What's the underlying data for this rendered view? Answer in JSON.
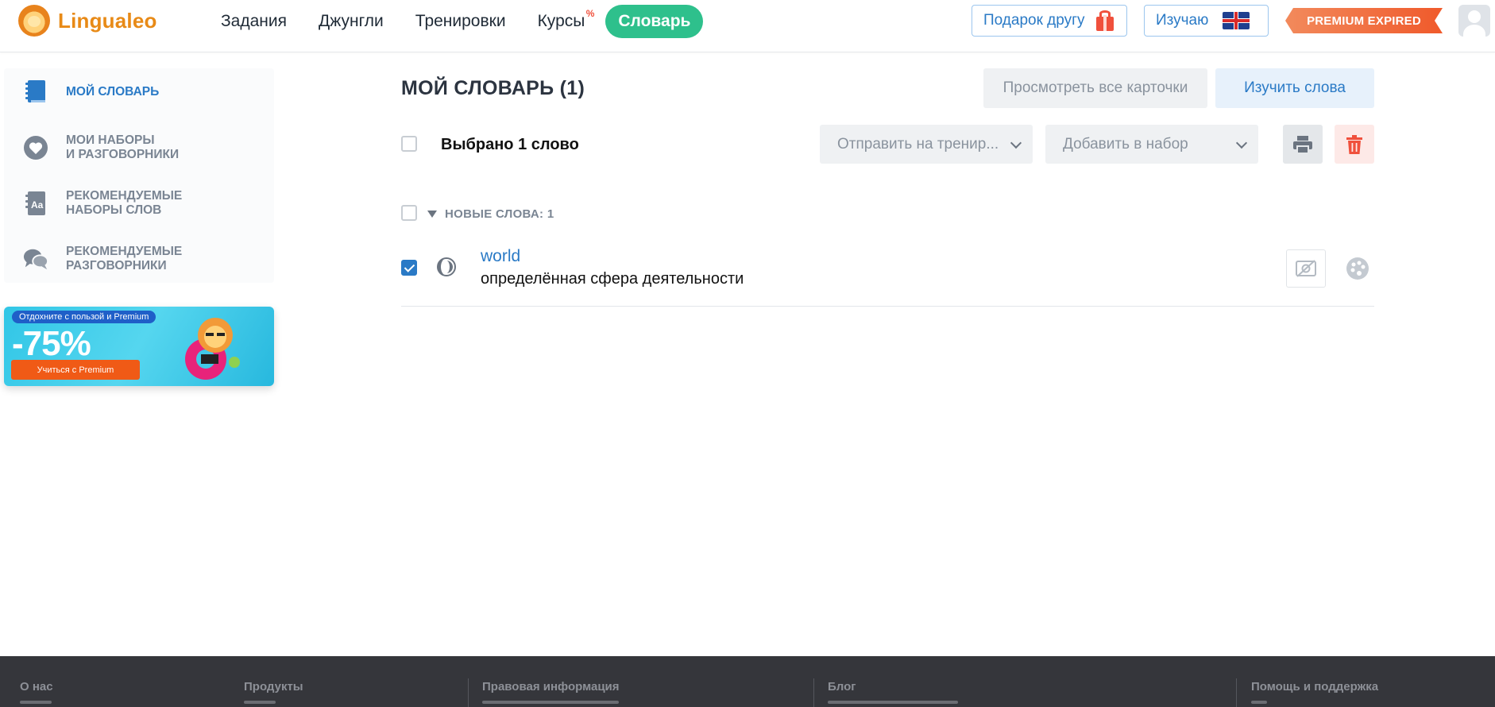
{
  "brand": {
    "name": "Lingualeo"
  },
  "nav": {
    "items": [
      {
        "label": "Задания"
      },
      {
        "label": "Джунгли"
      },
      {
        "label": "Тренировки"
      },
      {
        "label": "Курсы",
        "badge": "%"
      },
      {
        "label": "Словарь",
        "active": true
      }
    ]
  },
  "header": {
    "gift_label": "Подарок другу",
    "learning_label": "Изучаю",
    "premium_label": "PREMIUM EXPIRED"
  },
  "sidebar": {
    "items": [
      {
        "line1": "МОЙ СЛОВАРЬ",
        "line2": "",
        "icon": "dictionary-book-icon",
        "active": true
      },
      {
        "line1": "МОИ НАБОРЫ",
        "line2": "И РАЗГОВОРНИКИ",
        "icon": "heart-icon"
      },
      {
        "line1": "РЕКОМЕНДУЕМЫЕ",
        "line2": "НАБОРЫ СЛОВ",
        "icon": "word-set-icon"
      },
      {
        "line1": "РЕКОМЕНДУЕМЫЕ",
        "line2": "РАЗГОВОРНИКИ",
        "icon": "chat-bubbles-icon"
      }
    ]
  },
  "promo": {
    "tag": "Отдохните с пользой и Premium",
    "discount": "-75%",
    "button": "Учиться с Premium"
  },
  "main": {
    "title": "МОЙ СЛОВАРЬ (1)",
    "view_cards_label": "Просмотреть все карточки",
    "study_words_label": "Изучить слова",
    "selected_label": "Выбрано 1 слово",
    "send_to_training_label": "Отправить на тренир...",
    "add_to_set_label": "Добавить в набор",
    "group_label": "НОВЫЕ СЛОВА: 1",
    "words": [
      {
        "word": "world",
        "translation": "определённая сфера деятельности",
        "checked": true
      }
    ]
  },
  "colors": {
    "accent_blue": "#2a7ac6",
    "nav_active_green": "#2ec08c",
    "brand_orange": "#e88a17",
    "premium_orange": "#f05a2b",
    "delete_red": "#f0503c"
  },
  "footer": {
    "columns": [
      "О нас",
      "Продукты",
      "Правовая информация",
      "Блог",
      "Помощь и поддержка"
    ]
  }
}
